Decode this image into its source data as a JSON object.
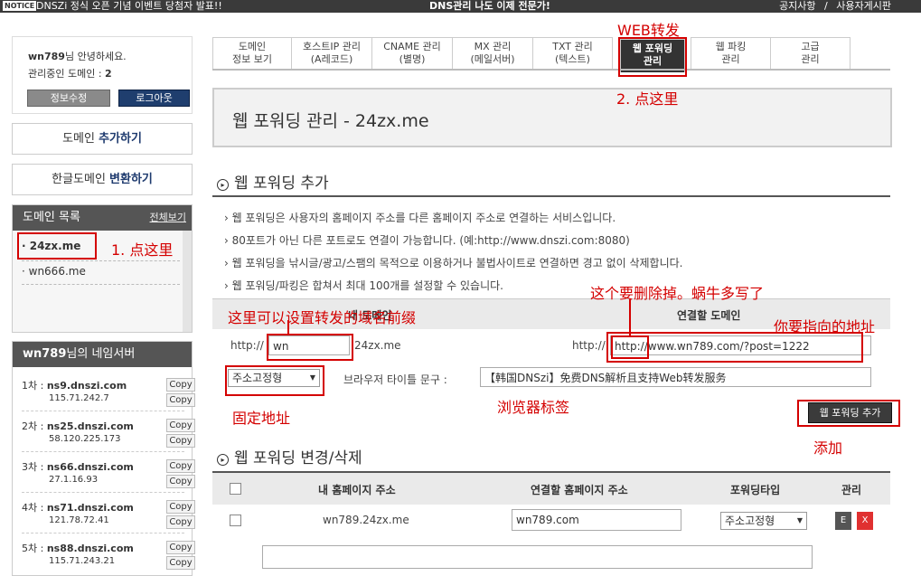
{
  "topbar": {
    "notice": "NOTICE",
    "left_text": "DNSZi 정식 오픈 기념 이벤트 당첨자 발표!!",
    "center_text": "DNS관리 나도 이제 전문가!",
    "links": [
      "공지사항",
      "/",
      "사용자게시판"
    ]
  },
  "user": {
    "name": "wn789",
    "greeting": "님 안녕하세요.",
    "managed_label": "관리중인 도메인 : ",
    "managed_count": "2",
    "edit_btn": "정보수정",
    "logout_btn": "로그아웃"
  },
  "sidebar": {
    "add_domain_prefix": "도메인 ",
    "add_domain_bold": "추가하기",
    "convert_prefix": "한글도메인 ",
    "convert_bold": "변환하기",
    "domain_list_title": "도메인 목록",
    "view_all": "전체보기",
    "domains": [
      "· 24zx.me",
      "· wn666.me"
    ],
    "ns_title_user": "wn789",
    "ns_title_suffix": "님의 네임서버",
    "nameservers": [
      {
        "label": "1차 : ",
        "host": "ns9.dnszi.com",
        "ip": "115.71.242.7"
      },
      {
        "label": "2차 : ",
        "host": "ns25.dnszi.com",
        "ip": "58.120.225.173"
      },
      {
        "label": "3차 : ",
        "host": "ns66.dnszi.com",
        "ip": "27.1.16.93"
      },
      {
        "label": "4차 : ",
        "host": "ns71.dnszi.com",
        "ip": "121.78.72.41"
      },
      {
        "label": "5차 : ",
        "host": "ns88.dnszi.com",
        "ip": "115.71.243.21"
      }
    ],
    "copy": "Copy"
  },
  "tabs": [
    {
      "l1": "도메인",
      "l2": "정보 보기"
    },
    {
      "l1": "호스트IP 관리",
      "l2": "(A레코드)"
    },
    {
      "l1": "CNAME 관리",
      "l2": "(별명)"
    },
    {
      "l1": "MX 관리",
      "l2": "(메일서버)"
    },
    {
      "l1": "TXT 관리",
      "l2": "(텍스트)"
    },
    {
      "l1": "웹 포워딩",
      "l2": "관리"
    },
    {
      "l1": "웹 파킹",
      "l2": "관리"
    },
    {
      "l1": "고급",
      "l2": "관리"
    }
  ],
  "page_title": "웹 포워딩 관리 - 24zx.me",
  "add_section": {
    "title": "웹 포워딩 추가",
    "info": [
      "› 웹 포워딩은 사용자의 홈페이지 주소를 다른 홈페이지 주소로 연결하는 서비스입니다.",
      "› 80포트가 아닌 다른 포트로도 연결이 가능합니다. (예:http://www.dnszi.com:8080)",
      "› 웹 포워딩을 낚시글/광고/스팸의 목적으로 이용하거나 불법사이트로 연결하면 경고 없이 삭제합니다.",
      "› 웹 포워딩/파킹은 합쳐서 최대 100개를 설정할 수 있습니다."
    ],
    "col_my_domain": "내 도메인",
    "col_target": "연결할 도메인",
    "http_prefix": "http://",
    "sub_value": "wn",
    "domain_suffix": "24zx.me",
    "target_value": "http://www.wn789.com/?post=1222",
    "type_select": "주소고정형",
    "browser_title_label": "브라우저 타이틀 문구 :",
    "browser_title_value": "【韩国DNSzi】免费DNS解析且支持Web转发服务",
    "add_btn": "웹 포워딩 추가"
  },
  "list_section": {
    "title": "웹 포워딩 변경/삭제",
    "headers": [
      "내 홈페이지 주소",
      "연결할 홈페이지 주소",
      "포워딩타입",
      "관리"
    ],
    "row": {
      "my_url": "wn789.24zx.me",
      "target": "wn789.com",
      "type": "주소고정형",
      "edit": "E",
      "delete": "X"
    }
  },
  "annotations": {
    "web_forward": "WEB转发",
    "click_here_2": "2. 点这里",
    "click_here_1": "1. 点这里",
    "delete_note": "这个要删除掉。蜗牛多写了",
    "prefix_note": "这里可以设置转发的域名前缀",
    "target_note": "你要指向的地址",
    "fixed_addr": "固定地址",
    "browser_tab": "浏览器标签",
    "add_note": "添加"
  },
  "colors": {
    "annotation": "#d40000",
    "accent_blue": "#1f3e6e"
  }
}
